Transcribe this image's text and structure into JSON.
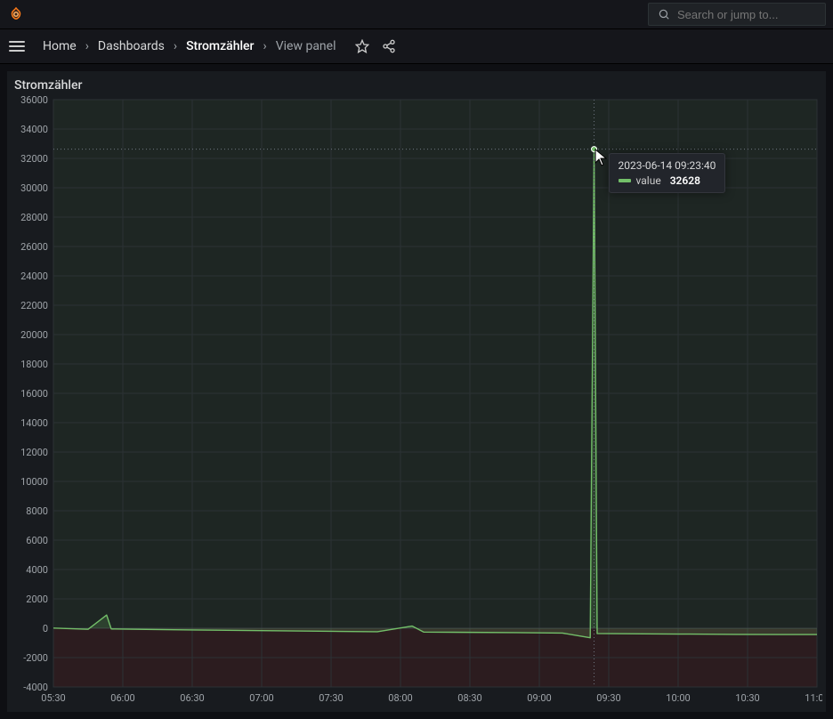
{
  "header": {
    "search_placeholder": "Search or jump to..."
  },
  "breadcrumbs": {
    "items": [
      {
        "label": "Home",
        "state": "link"
      },
      {
        "label": "Dashboards",
        "state": "link"
      },
      {
        "label": "Stromzähler",
        "state": "active"
      },
      {
        "label": "View panel",
        "state": "muted"
      }
    ]
  },
  "panel": {
    "title": "Stromzähler"
  },
  "tooltip": {
    "timestamp": "2023-06-14 09:23:40",
    "series_name": "value",
    "series_value": "32628"
  },
  "chart_data": {
    "type": "line",
    "title": "Stromzähler",
    "xlabel": "",
    "ylabel": "",
    "ylim": [
      -4000,
      36000
    ],
    "x_ticks": [
      "05:30",
      "06:00",
      "06:30",
      "07:00",
      "07:30",
      "08:00",
      "08:30",
      "09:00",
      "09:30",
      "10:00",
      "10:30",
      "11:00"
    ],
    "y_ticks": [
      -4000,
      -2000,
      0,
      2000,
      4000,
      6000,
      8000,
      10000,
      12000,
      14000,
      16000,
      18000,
      20000,
      22000,
      24000,
      26000,
      28000,
      30000,
      32000,
      34000,
      36000
    ],
    "series": [
      {
        "name": "value",
        "color": "#73bf69",
        "points": [
          {
            "x": "05:30",
            "y": 10
          },
          {
            "x": "05:45",
            "y": -70
          },
          {
            "x": "05:53",
            "y": 900
          },
          {
            "x": "05:55",
            "y": -50
          },
          {
            "x": "06:10",
            "y": -80
          },
          {
            "x": "06:30",
            "y": -120
          },
          {
            "x": "06:50",
            "y": -150
          },
          {
            "x": "07:10",
            "y": -180
          },
          {
            "x": "07:30",
            "y": -210
          },
          {
            "x": "07:50",
            "y": -240
          },
          {
            "x": "08:05",
            "y": 150
          },
          {
            "x": "08:10",
            "y": -260
          },
          {
            "x": "08:30",
            "y": -280
          },
          {
            "x": "08:50",
            "y": -300
          },
          {
            "x": "09:10",
            "y": -330
          },
          {
            "x": "09:22",
            "y": -650
          },
          {
            "x": "09:23:40",
            "y": 32628
          },
          {
            "x": "09:25",
            "y": -360
          },
          {
            "x": "09:45",
            "y": -380
          },
          {
            "x": "10:05",
            "y": -400
          },
          {
            "x": "10:25",
            "y": -420
          },
          {
            "x": "10:45",
            "y": -430
          },
          {
            "x": "11:00",
            "y": -430
          }
        ]
      }
    ],
    "crosshair": {
      "x": "09:23:40",
      "y": 32628
    }
  }
}
